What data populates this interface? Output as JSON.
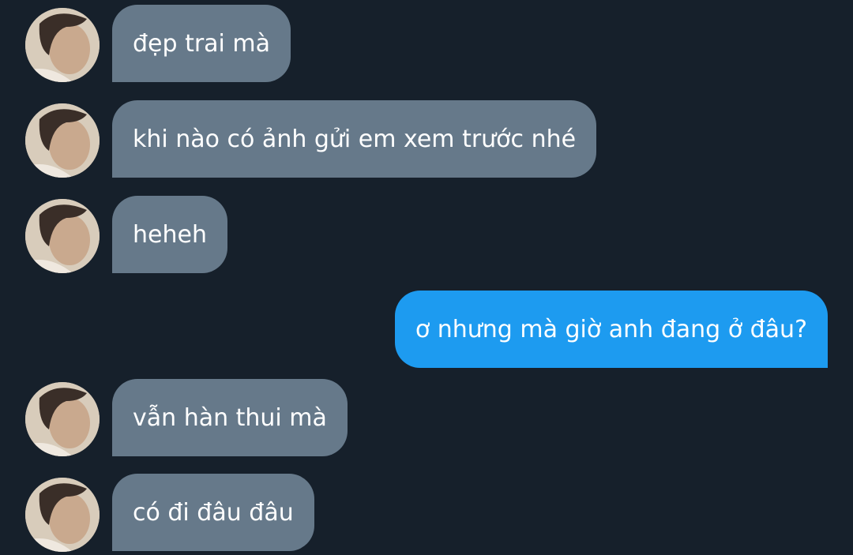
{
  "chat": {
    "messages": [
      {
        "sender": "contact",
        "text": "đẹp trai mà"
      },
      {
        "sender": "contact",
        "text": "khi nào có ảnh gửi em xem trước nhé"
      },
      {
        "sender": "contact",
        "text": "heheh"
      },
      {
        "sender": "me",
        "text": "ơ nhưng mà giờ anh đang ở đâu?"
      },
      {
        "sender": "contact",
        "text": "vẫn hàn thui mà"
      },
      {
        "sender": "contact",
        "text": "có đi đâu đâu"
      }
    ]
  },
  "colors": {
    "background": "#16202b",
    "incoming_bubble": "#66798a",
    "outgoing_bubble": "#1d9bf0",
    "text": "#ffffff"
  },
  "icons": {
    "avatar": "contact-avatar-photo"
  }
}
